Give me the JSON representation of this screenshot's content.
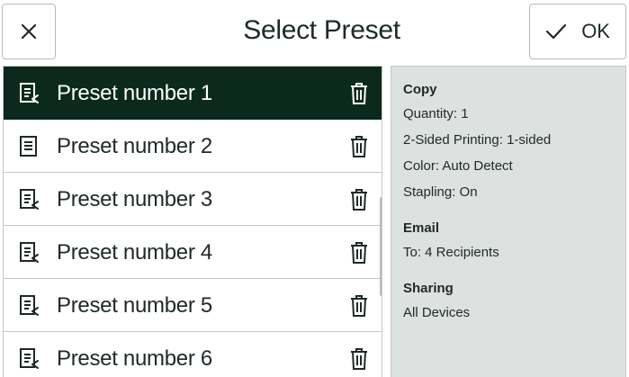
{
  "header": {
    "title": "Select Preset",
    "ok_label": "OK",
    "close_icon": "close-icon",
    "check_icon": "check-icon"
  },
  "presets": [
    {
      "label": "Preset number 1",
      "selected": true
    },
    {
      "label": "Preset number 2",
      "selected": false
    },
    {
      "label": "Preset number 3",
      "selected": false
    },
    {
      "label": "Preset number 4",
      "selected": false
    },
    {
      "label": "Preset number 5",
      "selected": false
    },
    {
      "label": "Preset number 6",
      "selected": false
    }
  ],
  "details": {
    "copy": {
      "heading": "Copy",
      "quantity": "Quantity: 1",
      "sided": "2-Sided Printing: 1-sided",
      "color": "Color: Auto Detect",
      "stapling": "Stapling: On"
    },
    "email": {
      "heading": "Email",
      "to": "To: 4 Recipients"
    },
    "sharing": {
      "heading": "Sharing",
      "value": "All Devices"
    }
  },
  "colors": {
    "selected_bg": "#0b2a1d",
    "details_bg": "#dde1df",
    "border": "#c4c9c6"
  }
}
